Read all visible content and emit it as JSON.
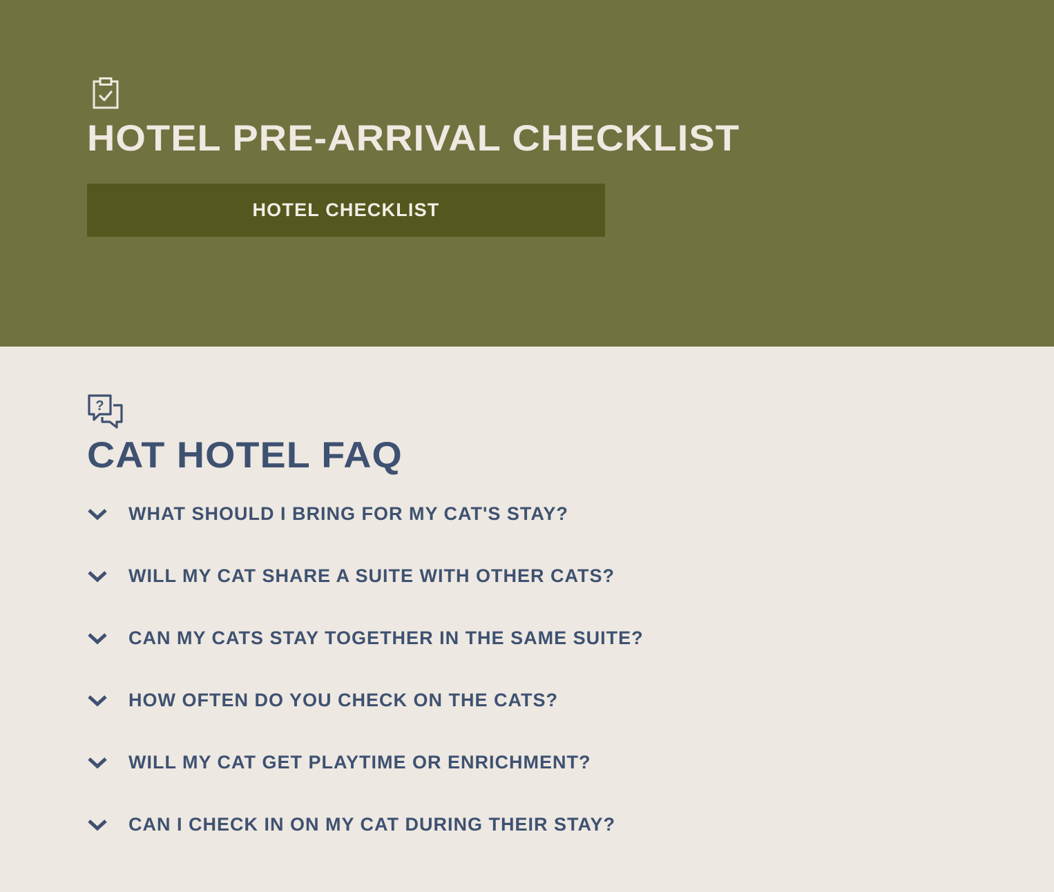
{
  "hero": {
    "icon": "clipboard-check-icon",
    "title": "HOTEL PRE-ARRIVAL CHECKLIST",
    "button_label": "HOTEL CHECKLIST",
    "background_color": "#707240",
    "button_color": "#55581e"
  },
  "faq": {
    "icon": "question-chat-bubbles-icon",
    "title": "CAT HOTEL FAQ",
    "text_color": "#3e5171",
    "items": [
      {
        "question": "WHAT SHOULD I BRING FOR MY CAT'S STAY?",
        "icon": "chevron-down-icon"
      },
      {
        "question": "WILL MY CAT SHARE A SUITE WITH OTHER CATS?",
        "icon": "chevron-down-icon"
      },
      {
        "question": "CAN MY CATS STAY TOGETHER IN THE SAME SUITE?",
        "icon": "chevron-down-icon"
      },
      {
        "question": "HOW OFTEN DO YOU CHECK ON THE CATS?",
        "icon": "chevron-down-icon"
      },
      {
        "question": "WILL MY CAT GET PLAYTIME OR ENRICHMENT?",
        "icon": "chevron-down-icon"
      },
      {
        "question": "CAN I CHECK IN ON MY CAT DURING THEIR STAY?",
        "icon": "chevron-down-icon"
      }
    ]
  }
}
